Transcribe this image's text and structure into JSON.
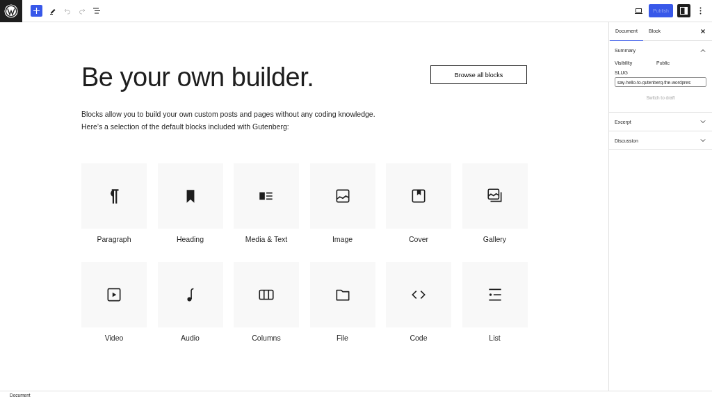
{
  "toolbar": {
    "undo": {
      "disabled": true
    },
    "redo": {
      "disabled": true
    },
    "publish": {
      "label": "Publish",
      "disabled": true
    },
    "settings": {
      "pressed": true
    }
  },
  "content": {
    "heading": "Be your own builder.",
    "browse_button": "Browse all blocks",
    "intro": [
      "Blocks allow you to build your own custom posts and pages without any coding knowledge.",
      "Here’s a selection of the default blocks included with Gutenberg:"
    ],
    "blocks": [
      {
        "label": "Paragraph"
      },
      {
        "label": "Heading"
      },
      {
        "label": "Media & Text"
      },
      {
        "label": "Image"
      },
      {
        "label": "Cover"
      },
      {
        "label": "Gallery"
      },
      {
        "label": "Video"
      },
      {
        "label": "Audio"
      },
      {
        "label": "Columns"
      },
      {
        "label": "File"
      },
      {
        "label": "Code"
      },
      {
        "label": "List"
      }
    ]
  },
  "sidebar": {
    "tabs": [
      {
        "label": "Document",
        "selected": true
      },
      {
        "label": "Block",
        "selected": false
      }
    ],
    "panels": [
      {
        "title": "Summary",
        "expanded": true,
        "visibility_label": "Visibility",
        "visibility_value": "Public",
        "slug_label": "SLUG",
        "slug_value": "say-hello-to-gutenberg-the-wordpres",
        "switch_button": "Switch to draft"
      },
      {
        "title": "Excerpt",
        "expanded": false
      },
      {
        "title": "Discussion",
        "expanded": false
      }
    ]
  },
  "footer": {
    "breadcrumb": "Document"
  }
}
